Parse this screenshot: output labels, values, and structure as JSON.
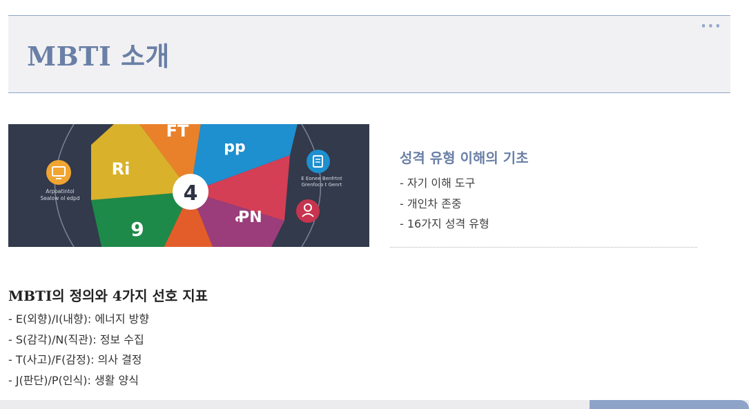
{
  "header": {
    "title": "MBTI 소개",
    "more_icon": "more-horizontal-icon"
  },
  "figure": {
    "center_label": "4",
    "segment_labels": [
      "FT",
      "pp",
      "Ri",
      "ꝒN",
      "9"
    ],
    "left_caption": [
      "Arpoatintol",
      "Sealow ol edpd"
    ],
    "right_caption": [
      "E Eonee Benfrtnt",
      "Grenfoco t Genrt"
    ],
    "icons": [
      "monitor-icon",
      "document-icon",
      "person-icon"
    ],
    "colors": {
      "background": "#323a4b",
      "orange": "#e9812b",
      "blue": "#1e8fcf",
      "red": "#d43f56",
      "purple": "#9b3d7a",
      "yellow": "#d9b12b",
      "green": "#1e8a49",
      "orange_red": "#e35d2a"
    }
  },
  "side": {
    "title": "성격 유형 이해의 기초",
    "items": [
      "- 자기 이해 도구",
      "- 개인차 존중",
      "- 16가지 성격 유형"
    ]
  },
  "definition": {
    "title": "MBTI의 정의와 4가지 선호 지표",
    "items": [
      "- E(외향)/I(내향): 에너지 방향",
      "- S(감각)/N(직관): 정보 수집",
      "- T(사고)/F(감정): 의사 결정",
      "- J(판단)/P(인식): 생활 양식"
    ]
  },
  "theme": {
    "accent": "#6a7fa6",
    "line": "#8ea3c8",
    "header_bg": "#f1f1f3"
  }
}
